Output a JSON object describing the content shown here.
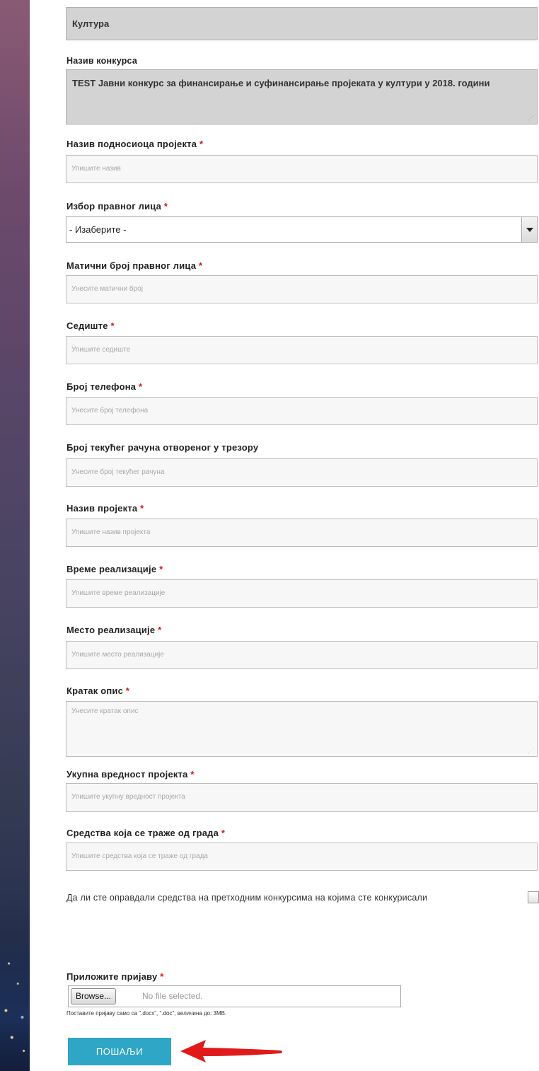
{
  "category": {
    "value": "Култура"
  },
  "competition": {
    "label": "Назив конкурса",
    "value": "TEST Јавни конкурс за финансирање и суфинансирање пројеката у култури у 2018. години"
  },
  "fields": {
    "applicant_name": {
      "label": "Назив подносиоца пројекта",
      "required": "*",
      "placeholder": "Упишите назив"
    },
    "legal_entity": {
      "label": "Избор правног лица",
      "required": "*",
      "selected": "- Изаберите -"
    },
    "registry_number": {
      "label": "Матични број правног лица",
      "required": "*",
      "placeholder": "Унесите матични број"
    },
    "seat": {
      "label": "Седиште",
      "required": "*",
      "placeholder": "Упишите седиште"
    },
    "phone": {
      "label": "Број телефона",
      "required": "*",
      "placeholder": "Унесите број телефона"
    },
    "account": {
      "label": "Број текућег рачуна отвореног у трезору",
      "placeholder": "Унесите број текућег рачуна"
    },
    "project_name": {
      "label": "Назив пројекта",
      "required": "*",
      "placeholder": "Упишите назив пројекта"
    },
    "realization_time": {
      "label": "Време реализације",
      "required": "*",
      "placeholder": "Упишите време реализације"
    },
    "realization_place": {
      "label": "Место реализације",
      "required": "*",
      "placeholder": "Упишите место реализације"
    },
    "short_description": {
      "label": "Кратак опис",
      "required": "*",
      "placeholder": "Унесите кратак опис"
    },
    "total_value": {
      "label": "Укупна вредност пројекта",
      "required": "*",
      "placeholder": "Упишите укупну вредност пројекта"
    },
    "requested_funds": {
      "label": "Средства која се траже од града",
      "required": "*",
      "placeholder": "Упишите средства која се траже од града"
    }
  },
  "justified_question": "Да ли сте оправдали средства на претходним конкурсима на којима сте конкурисали",
  "attachment": {
    "label": "Приложите пријаву",
    "required": "*",
    "browse_label": "Browse...",
    "no_file": "No file selected.",
    "hint": "Поставите пријаву само са \".docx\", \".doc\", величина до: 3MB."
  },
  "submit_label": "ПОШАЉИ",
  "colors": {
    "submit": "#2fa6c5",
    "required": "#d01818",
    "arrow": "#e01a1a"
  }
}
